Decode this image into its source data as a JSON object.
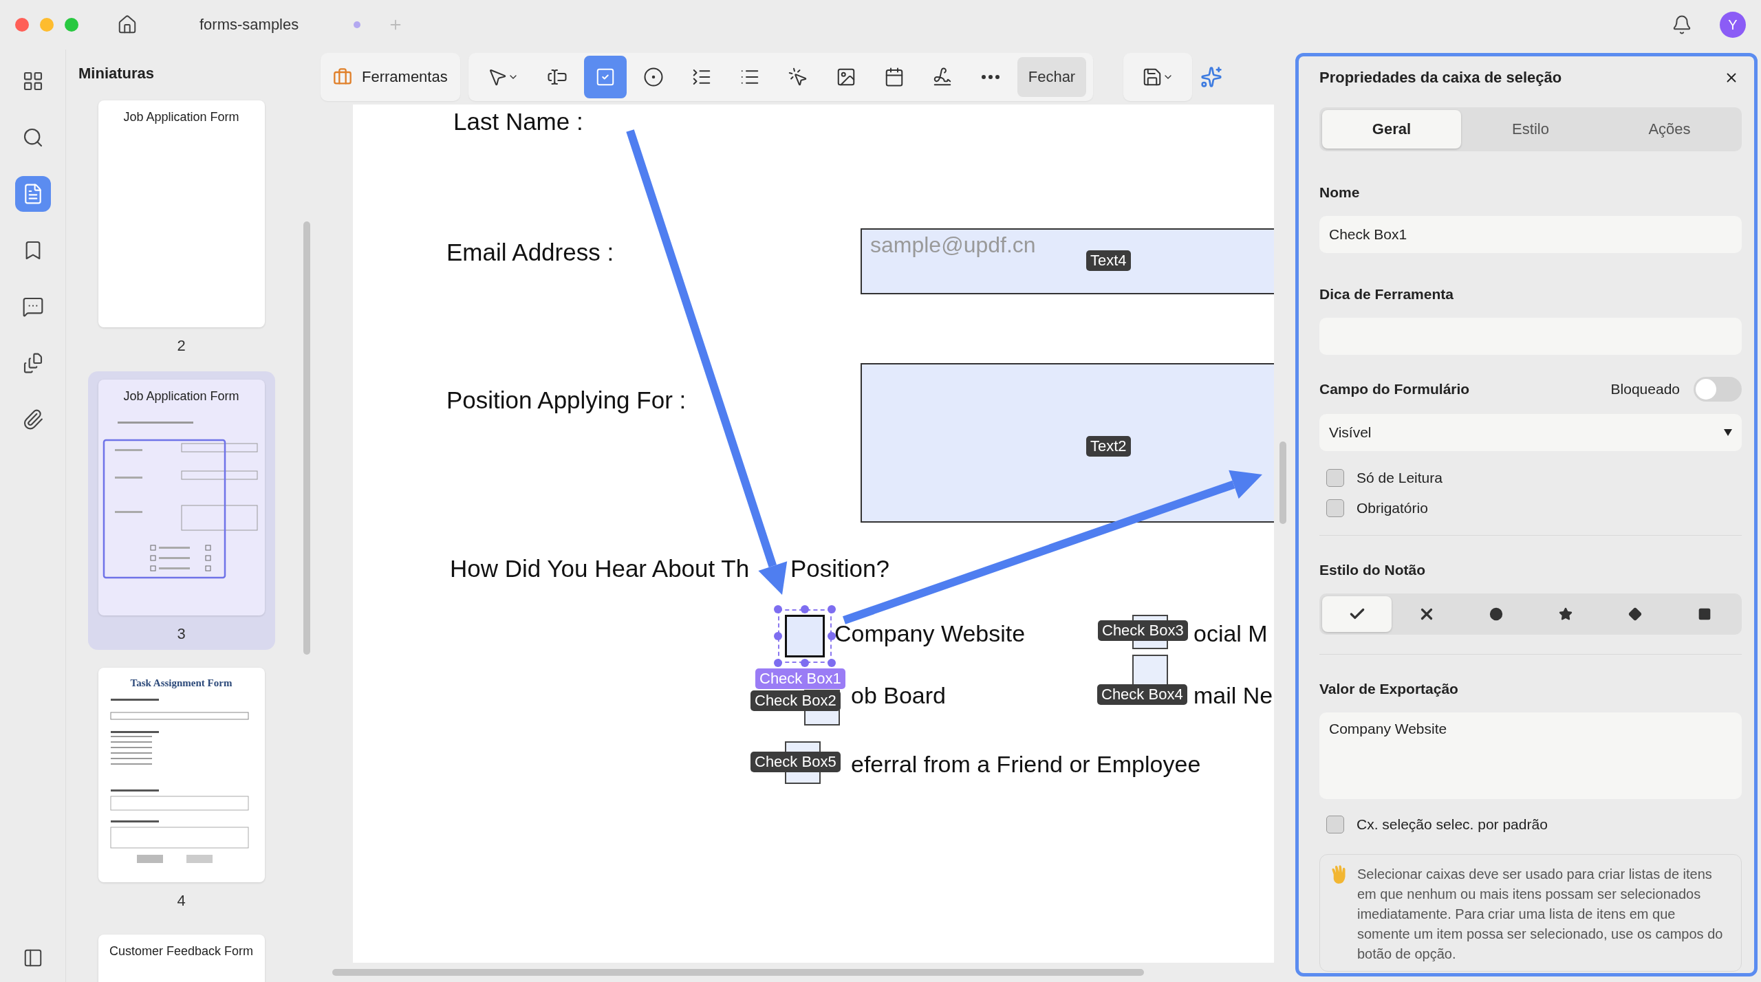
{
  "window": {
    "tab_title": "forms-samples",
    "user_initial": "Y"
  },
  "sidebar": {
    "items": [
      {
        "kind": "apps",
        "selected": false
      },
      {
        "kind": "search",
        "selected": false
      },
      {
        "kind": "pages",
        "selected": true
      },
      {
        "kind": "bookmark",
        "selected": false
      },
      {
        "kind": "comment",
        "selected": false
      },
      {
        "kind": "forms",
        "selected": false
      },
      {
        "kind": "attachment",
        "selected": false
      }
    ]
  },
  "thumbnails": {
    "title": "Miniaturas",
    "pages": [
      {
        "title": "Job Application Form",
        "number": "2",
        "selected": false,
        "kind": "blank"
      },
      {
        "title": "Job Application Form",
        "number": "3",
        "selected": true,
        "kind": "form"
      },
      {
        "title": "Task Assignment Form",
        "number": "4",
        "selected": false,
        "kind": "task"
      },
      {
        "title": "Customer Feedback Form",
        "selected": false,
        "kind": "blank"
      }
    ]
  },
  "toolbar": {
    "tools_label": "Ferramentas",
    "tools": [
      {
        "kind": "pointer",
        "selected": false
      },
      {
        "kind": "text-field",
        "selected": false
      },
      {
        "kind": "checkbox",
        "selected": true
      },
      {
        "kind": "radio",
        "selected": false
      },
      {
        "kind": "combo",
        "selected": false
      },
      {
        "kind": "list",
        "selected": false
      },
      {
        "kind": "button",
        "selected": false
      },
      {
        "kind": "image",
        "selected": false
      },
      {
        "kind": "date",
        "selected": false
      },
      {
        "kind": "signature",
        "selected": false
      },
      {
        "kind": "more",
        "selected": false
      }
    ],
    "close_label": "Fechar"
  },
  "document": {
    "labels": [
      "Last Name :",
      "Email Address :",
      "Position Applying For :",
      "How Did You Hear About Th",
      "Position?"
    ],
    "text_fields": [
      {
        "tag": "Text4",
        "placeholder": "sample@updf.cn"
      },
      {
        "tag": "Text2"
      }
    ],
    "checkboxes": [
      {
        "tag": "Check Box1",
        "label": "Company Website",
        "selected": true
      },
      {
        "tag": "Check Box3",
        "label": "ocial M",
        "selected": false
      },
      {
        "tag": "Check Box2",
        "label": "ob Board",
        "selected": false
      },
      {
        "tag": "Check Box4",
        "label": "mail Ne",
        "selected": false
      },
      {
        "tag": "Check Box5",
        "label": "eferral from a Friend or Employee",
        "selected": false
      }
    ]
  },
  "panel": {
    "title": "Propriedades da caixa de seleção",
    "tabs": [
      {
        "label": "Geral",
        "selected": true
      },
      {
        "label": "Estilo",
        "selected": false
      },
      {
        "label": "Ações",
        "selected": false
      }
    ],
    "name_label": "Nome",
    "name_value": "Check Box1",
    "tooltip_label": "Dica de Ferramenta",
    "form_field_label": "Campo do Formulário",
    "locked_label": "Bloqueado",
    "locked": false,
    "visibility": "Visível",
    "options": [
      {
        "label": "Só de Leitura",
        "checked": false
      },
      {
        "label": "Obrigatório",
        "checked": false
      }
    ],
    "style_label": "Estilo do Notão",
    "styles": [
      {
        "kind": "check",
        "selected": true
      },
      {
        "kind": "cross",
        "selected": false
      },
      {
        "kind": "circle",
        "selected": false
      },
      {
        "kind": "star",
        "selected": false
      },
      {
        "kind": "diamond",
        "selected": false
      },
      {
        "kind": "square",
        "selected": false
      }
    ],
    "export_label": "Valor de Exportação",
    "export_value": "Company Website",
    "default_checked_label": "Cx. seleção selec. por padrão",
    "default_checked": false,
    "note": "Selecionar caixas deve ser usado para criar listas de itens em que nenhum ou mais itens possam ser selecionados imediatamente. Para criar uma lista de itens em que somente um item possa ser selecionado, use os campos do botão de opção."
  }
}
